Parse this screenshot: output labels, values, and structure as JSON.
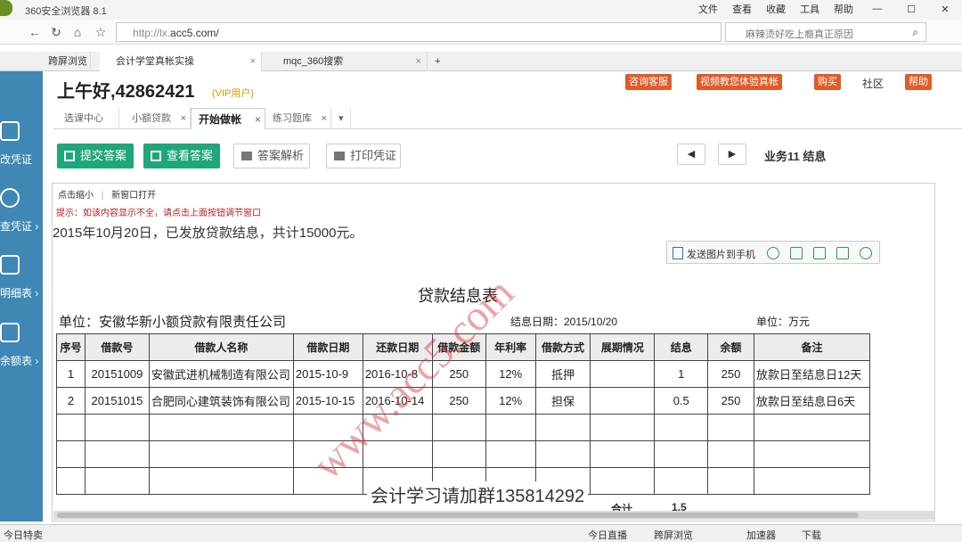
{
  "window": {
    "title": "360安全浏览器 8.1",
    "menus": [
      "文件",
      "查看",
      "收藏",
      "工具",
      "帮助"
    ]
  },
  "address": {
    "url_prefix": "http://lx.",
    "url_host": "acc5.com/",
    "search_placeholder": "麻辣烫好吃上瘾真正原因"
  },
  "tabs": [
    {
      "label": "跨屏浏览"
    },
    {
      "label": "会计学堂真帐实操"
    },
    {
      "label": "mqc_360搜索"
    }
  ],
  "sidebar": [
    {
      "label": "改凭证"
    },
    {
      "label": "查凭证 ›"
    },
    {
      "label": "明细表 ›"
    },
    {
      "label": "余额表 ›"
    }
  ],
  "header": {
    "greeting": "上午好,42862421",
    "vip": "(VIP用户)",
    "actions": [
      "咨询客服",
      "视频教您体验真帐",
      "购买",
      "社区",
      "帮助"
    ]
  },
  "subtabs": [
    {
      "label": "选课中心"
    },
    {
      "label": "小额贷款"
    },
    {
      "label": "开始做帐"
    },
    {
      "label": "练习题库"
    }
  ],
  "toolbar": {
    "submit": "提交答案",
    "view": "查看答案",
    "analysis": "答案解析",
    "print": "打印凭证",
    "business": "业务11  结息"
  },
  "doc": {
    "zoom": "点击缩小",
    "new_window": "新窗口打开",
    "hint": "提示：如该内容显示不全，请点击上面按钮调节窗口",
    "description": "2015年10月20日，已发放贷款结息，共计15000元。",
    "send_phone": "发送图片到手机"
  },
  "report": {
    "title": "贷款结息表",
    "unit": "单位：安徽华新小额贷款有限责任公司",
    "date": "结息日期：2015/10/20",
    "unit2": "单位：万元",
    "headers": [
      "序号",
      "借款号",
      "借款人名称",
      "借款日期",
      "还款日期",
      "借款金额",
      "年利率",
      "借款方式",
      "展期情况",
      "结息",
      "余额",
      "备注"
    ],
    "rows": [
      [
        "1",
        "20151009",
        "安徽武进机械制造有限公司",
        "2015-10-9",
        "2016-10-8",
        "250",
        "12%",
        "抵押",
        "",
        "1",
        "250",
        "放款日至结息日12天"
      ],
      [
        "2",
        "20151015",
        "合肥同心建筑装饰有限公司",
        "2015-10-15",
        "2016-10-14",
        "250",
        "12%",
        "担保",
        "",
        "0.5",
        "250",
        "放款日至结息日6天"
      ]
    ],
    "total_label": "合计",
    "total_value": "1.5"
  },
  "watermark": "www.acc5.com",
  "qq": "会计学习请加群135814292",
  "statusbar": {
    "left": "今日特卖",
    "items": [
      "今日直播",
      "跨屏浏览",
      "加速器",
      "下载"
    ]
  }
}
